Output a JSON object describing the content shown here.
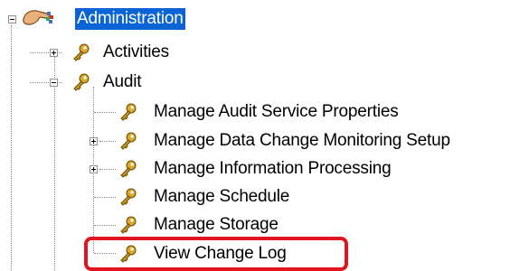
{
  "tree": {
    "root": {
      "label": "Administration",
      "expander": "minus",
      "icon": "admin-hand-icon",
      "selected": true
    },
    "items": [
      {
        "label": "Activities",
        "expander": "plus",
        "icon": "key-icon"
      },
      {
        "label": "Audit",
        "expander": "minus",
        "icon": "key-icon"
      },
      {
        "label": "Manage Audit Service Properties",
        "expander": "none",
        "icon": "key-icon"
      },
      {
        "label": "Manage Data Change Monitoring Setup",
        "expander": "plus",
        "icon": "key-icon"
      },
      {
        "label": "Manage Information Processing",
        "expander": "plus",
        "icon": "key-icon"
      },
      {
        "label": "Manage Schedule",
        "expander": "none",
        "icon": "key-icon"
      },
      {
        "label": "Manage Storage",
        "expander": "none",
        "icon": "key-icon"
      },
      {
        "label": "View Change Log",
        "expander": "none",
        "icon": "key-icon",
        "annotated": true
      }
    ]
  },
  "colors": {
    "selection": "#0a64d6",
    "annotation_outline": "#e0141d",
    "key": "#c89a1e"
  }
}
